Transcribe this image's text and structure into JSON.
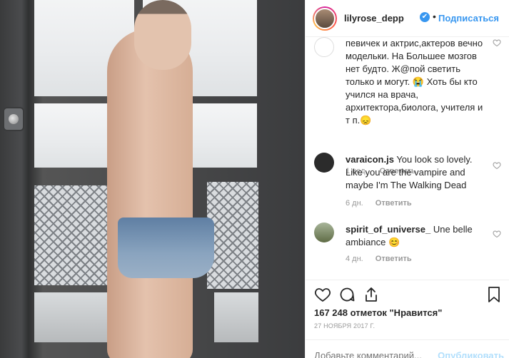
{
  "header": {
    "username": "lilyrose_depp",
    "verified_glyph": "✔",
    "separator": "•",
    "follow_label": "Подписаться"
  },
  "comments": [
    {
      "user": "",
      "text": "певичек и актрис,актеров вечно модельки. На Большее мозгов нет будто. Ж@пой светить только и могут. 😭 Хоть бы кто учился на врача, архитектора,биолога, учителя и т п.😞",
      "time": "1 нед.",
      "reply": "Ответить",
      "avatar_color": "#efe9e2"
    },
    {
      "user": "varaicon.js",
      "text": " You look so lovely. Like you are the vampire and maybe I'm The Walking Dead",
      "time": "6 дн.",
      "reply": "Ответить",
      "avatar_color": "#2b2b2b"
    },
    {
      "user": "spirit_of_universe_",
      "text": " Une belle ambiance 😊",
      "time": "4 дн.",
      "reply": "Ответить",
      "avatar_color": "#6d7a55"
    }
  ],
  "actions": {
    "like_icon": "heart-icon",
    "comment_icon": "comment-icon",
    "share_icon": "share-icon",
    "save_icon": "bookmark-icon"
  },
  "likes_text": "167 248 отметок \"Нравится\"",
  "date_text": "27 НОЯБРЯ 2017 Г.",
  "add_comment": {
    "placeholder": "Добавьте комментарий...",
    "publish_label": "Опубликовать"
  },
  "colors": {
    "accent": "#3897f0",
    "text": "#262626",
    "muted": "#999999",
    "publish_disabled": "#b2dffc"
  }
}
